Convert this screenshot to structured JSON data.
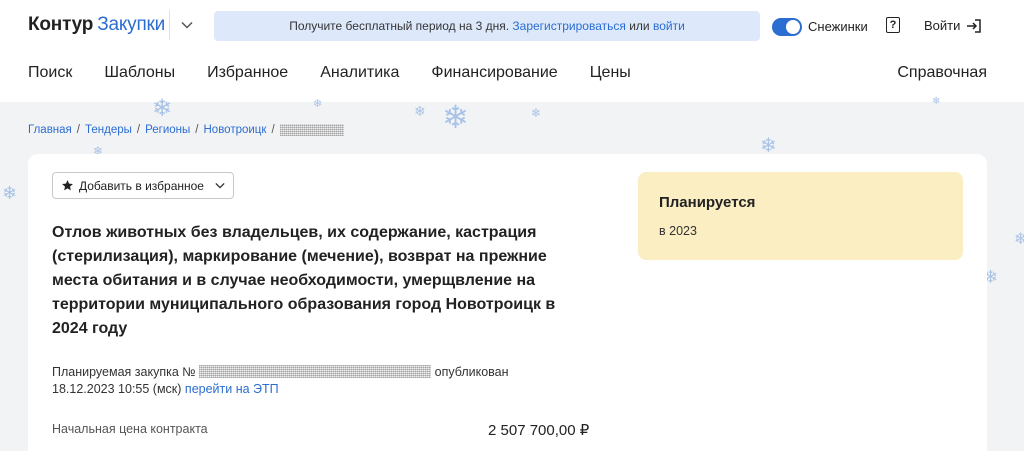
{
  "header": {
    "logo_part1": "Контур",
    "logo_part2": "Закупки",
    "banner": {
      "text_before": "Получите бесплатный период на 3 дня.",
      "register_link": "Зарегистрироваться",
      "text_or": "или",
      "login_link": "войти"
    },
    "toggle": {
      "label": "Снежинки",
      "on": true
    },
    "help_label": "?",
    "login_label": "Войти",
    "nav": [
      "Поиск",
      "Шаблоны",
      "Избранное",
      "Аналитика",
      "Финансирование",
      "Цены"
    ],
    "nav_right": "Справочная"
  },
  "breadcrumb": [
    "Главная",
    "Тендеры",
    "Регионы",
    "Новотроицк"
  ],
  "card": {
    "favorite_button": "Добавить в избранное",
    "title": "Отлов животных без владельцев, их содержание, кастрация (стерилизация), маркирование (мечение), возврат на прежние места обитания и в случае необходимости, умерщвление на территории муниципального образования город Новотроицк в 2024 году",
    "meta_prefix": "Планируемая закупка №",
    "meta_published": "опубликован",
    "meta_datetime": "18.12.2023 10:55 (мск)",
    "etp_link": "перейти на ЭТП",
    "price_label": "Начальная цена контракта",
    "price_value": "2 507 700,00 ₽",
    "status_title": "Планируется",
    "status_year": "в 2023"
  },
  "colors": {
    "accent": "#2b6dd1",
    "banner_bg": "#dde9fb",
    "status_bg": "#fbeec2",
    "page_bg": "#f2f3f5",
    "snowflake": "#a9c3e6"
  },
  "icons": {
    "header_chevron": "chevron-down-icon",
    "help": "question-icon",
    "login": "login-arrow-icon",
    "favorite": "star-icon",
    "favorite_chevron": "chevron-down-icon",
    "decor": "snowflake-icon"
  }
}
